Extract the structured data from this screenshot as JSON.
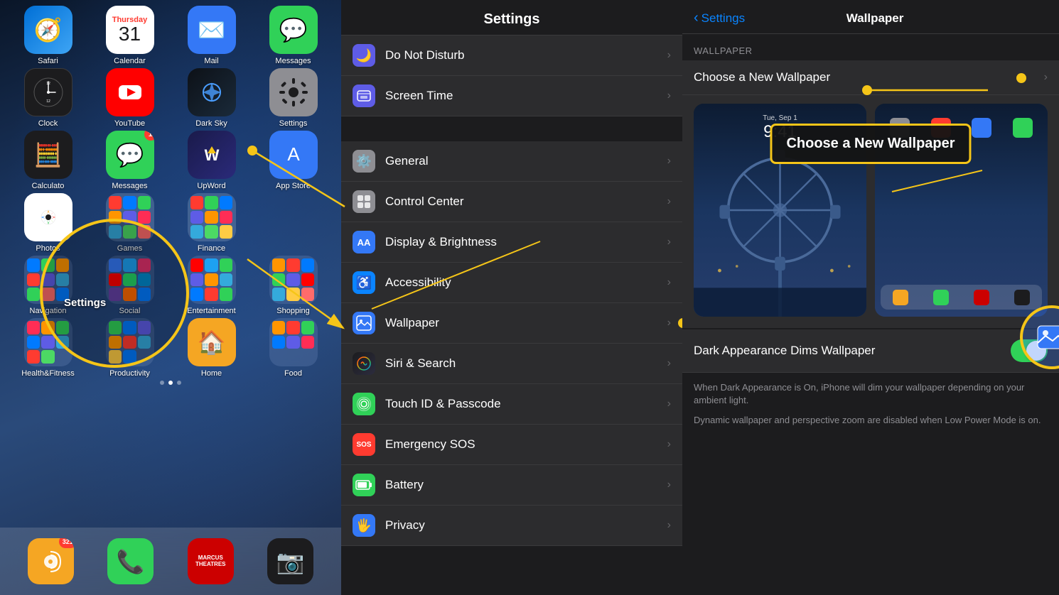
{
  "homeScreen": {
    "apps_row1": [
      {
        "id": "safari",
        "label": "Safari",
        "icon": "🧭",
        "bg": "linear-gradient(135deg,#006fd6,#3ea5f5)"
      },
      {
        "id": "calendar",
        "label": "Calendar",
        "icon": "calendar",
        "bg": "white"
      },
      {
        "id": "mail",
        "label": "Mail",
        "icon": "✉️",
        "bg": "#3478f6"
      },
      {
        "id": "messages",
        "label": "Messages",
        "icon": "💬",
        "bg": "#30d158"
      }
    ],
    "apps_row2": [
      {
        "id": "clock",
        "label": "Clock",
        "icon": "clock",
        "bg": "#1c1c1e"
      },
      {
        "id": "youtube",
        "label": "YouTube",
        "icon": "▶",
        "bg": "#ff0000"
      },
      {
        "id": "darksky",
        "label": "Dark Sky",
        "icon": "⚡",
        "bg": "#1c2a3a"
      },
      {
        "id": "settings",
        "label": "Settings",
        "icon": "⚙️",
        "bg": "#8e8e93",
        "highlighted": true
      }
    ],
    "apps_row3": [
      {
        "id": "calculator",
        "label": "Calculato",
        "icon": "🧮",
        "bg": "#1c1c1e"
      },
      {
        "id": "messages2",
        "label": "Messages",
        "icon": "💬",
        "bg": "#30d158",
        "badge": "1"
      },
      {
        "id": "upword",
        "label": "UpWord",
        "icon": "📝",
        "bg": "#2a2a5a"
      },
      {
        "id": "appstore",
        "label": "App Store",
        "icon": "🅰",
        "bg": "#3478f6"
      }
    ],
    "apps_row4": [
      {
        "id": "photos",
        "label": "Photos",
        "icon": "🖼",
        "bg": "#f2f2f7"
      },
      {
        "id": "games_folder",
        "label": "Games",
        "icon": "folder",
        "bg": "rgba(100,120,160,0.6)"
      },
      {
        "id": "finance_folder",
        "label": "Finance",
        "icon": "folder",
        "bg": "rgba(100,120,160,0.6)"
      }
    ],
    "folders_row5": [
      {
        "id": "navigation_folder",
        "label": "Navigation",
        "icon": "folder"
      },
      {
        "id": "social_folder",
        "label": "Social",
        "icon": "folder"
      },
      {
        "id": "entertainment_folder",
        "label": "Entertainment",
        "icon": "folder"
      },
      {
        "id": "shopping_folder",
        "label": "Shopping",
        "icon": "folder"
      }
    ],
    "folders_row6": [
      {
        "id": "healthfitness_folder",
        "label": "Health&Fitness",
        "icon": "folder"
      },
      {
        "id": "productivity_folder",
        "label": "Productivity",
        "icon": "folder"
      },
      {
        "id": "home_app",
        "label": "Home",
        "icon": "🏠",
        "bg": "#f5a623"
      },
      {
        "id": "food_folder",
        "label": "Food",
        "icon": "folder"
      }
    ],
    "dock": [
      {
        "id": "podcast",
        "label": "",
        "icon": "📡",
        "bg": "#f5a623",
        "badge": "321"
      },
      {
        "id": "phone",
        "label": "",
        "icon": "📞",
        "bg": "#30d158"
      },
      {
        "id": "marcustheatres",
        "label": "",
        "icon": "🎬",
        "bg": "#cc0000"
      },
      {
        "id": "camera",
        "label": "",
        "icon": "📷",
        "bg": "#1c1c1e"
      }
    ]
  },
  "settingsPanel": {
    "title": "Settings",
    "items": [
      {
        "id": "do-not-disturb",
        "label": "Do Not Disturb",
        "iconBg": "#5e5ce6",
        "icon": "🌙"
      },
      {
        "id": "screen-time",
        "label": "Screen Time",
        "iconBg": "#5e5ce6",
        "icon": "⏱"
      },
      {
        "separator": true
      },
      {
        "id": "general",
        "label": "General",
        "iconBg": "#8e8e93",
        "icon": "⚙️"
      },
      {
        "id": "control-center",
        "label": "Control Center",
        "iconBg": "#8e8e93",
        "icon": "⚡"
      },
      {
        "id": "display",
        "label": "Display & Brightness",
        "iconBg": "#3478f6",
        "icon": "AA"
      },
      {
        "id": "accessibility",
        "label": "Accessibility",
        "iconBg": "#0a84ff",
        "icon": "♿"
      },
      {
        "id": "wallpaper",
        "label": "Wallpaper",
        "iconBg": "#3478f6",
        "icon": "🎨",
        "highlighted": true
      },
      {
        "id": "siri",
        "label": "Siri & Search",
        "iconBg": "#1c1c1e",
        "icon": "🌈"
      },
      {
        "id": "touch-id",
        "label": "Touch ID & Passcode",
        "iconBg": "#30d158",
        "icon": "👆"
      },
      {
        "id": "sos",
        "label": "Emergency SOS",
        "iconBg": "#ff3b30",
        "icon": "SOS"
      },
      {
        "id": "battery",
        "label": "Battery",
        "iconBg": "#30d158",
        "icon": "🔋"
      },
      {
        "id": "privacy",
        "label": "Privacy",
        "iconBg": "#3478f6",
        "icon": "🖐"
      }
    ]
  },
  "wallpaperPanel": {
    "navBack": "Settings",
    "title": "Wallpaper",
    "sectionHeader": "WALLPAPER",
    "chooseNew": "Choose a New Wallpaper",
    "calloutText": "Choose a New Wallpaper",
    "darkAppearanceLabel": "Dark Appearance Dims Wallpaper",
    "darkAppearanceEnabled": true,
    "description1": "When Dark Appearance is On, iPhone will dim your wallpaper depending on your ambient light.",
    "description2": "Dynamic wallpaper and perspective zoom are disabled when Low Power Mode is on."
  },
  "annotations": {
    "settingsHighlight": true,
    "wallpaperHighlight": true,
    "calloutBox": true,
    "arrowColor": "#f5c518"
  }
}
